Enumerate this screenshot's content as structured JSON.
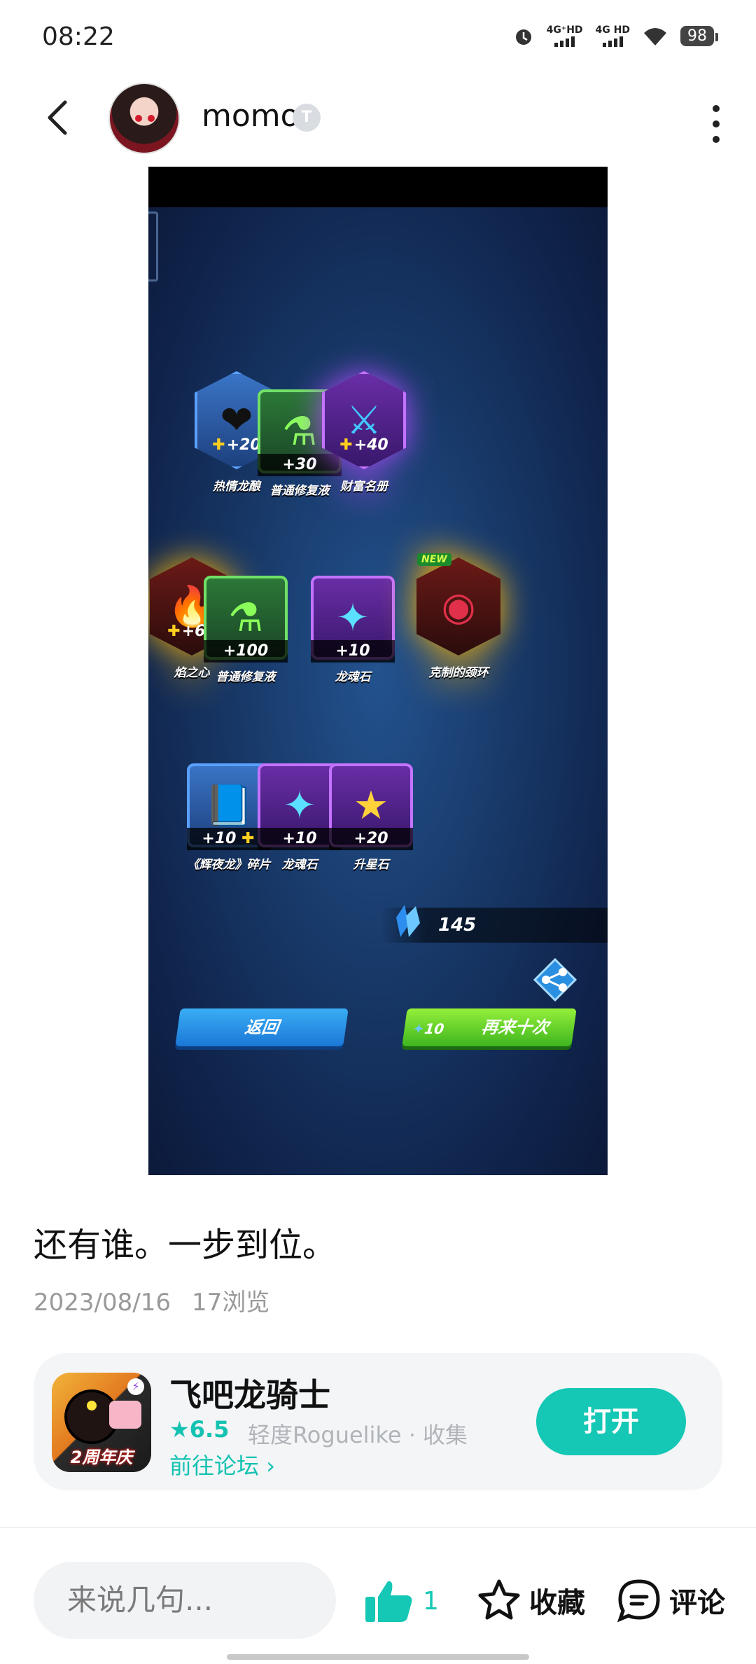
{
  "status_bar": {
    "time": "08:22",
    "network_1": "4G⁺HD",
    "network_2": "4G HD",
    "battery": "98",
    "icons": [
      "alarm-icon",
      "signal-icon",
      "signal-icon",
      "wifi-icon",
      "battery-icon"
    ]
  },
  "header": {
    "username": "momo",
    "badge": "T",
    "icons": [
      "back-arrow-icon",
      "more-vertical-icon"
    ]
  },
  "game": {
    "items": [
      {
        "name": "热情龙酿",
        "qty": "+20",
        "puzzle": true,
        "new": false
      },
      {
        "name": "普通修复液",
        "qty": "+30",
        "puzzle": false,
        "new": false
      },
      {
        "name": "财富名册",
        "qty": "+40",
        "puzzle": true,
        "new": false
      },
      {
        "name": "焰之心",
        "qty": "+60",
        "puzzle": true,
        "new": false
      },
      {
        "name": "普通修复液",
        "qty": "+100",
        "puzzle": false,
        "new": false
      },
      {
        "name": "龙魂石",
        "qty": "+10",
        "puzzle": false,
        "new": false
      },
      {
        "name": "克制的颈环",
        "qty": "",
        "puzzle": false,
        "new": true
      },
      {
        "name": "《辉夜龙》碎片",
        "qty": "+10",
        "puzzle": true,
        "new": false
      },
      {
        "name": "龙魂石",
        "qty": "+10",
        "puzzle": false,
        "new": false
      },
      {
        "name": "升星石",
        "qty": "+20",
        "puzzle": false,
        "new": false
      }
    ],
    "new_tag": "NEW",
    "crystal_count": "145",
    "back_button": "返回",
    "again_cost": "10",
    "again_button": "再来十次"
  },
  "post": {
    "text": "还有谁。一步到位。",
    "date": "2023/08/16",
    "views": "17浏览"
  },
  "app_card": {
    "name": "飞吧龙骑士",
    "rating": "6.5",
    "tags": "轻度Roguelike · 收集",
    "forum_link": "前往论坛",
    "icon_banner": "2周年庆",
    "open_button": "打开"
  },
  "bottom_bar": {
    "comment_placeholder": "来说几句...",
    "like_count": "1",
    "favorite_label": "收藏",
    "comment_label": "评论"
  },
  "colors": {
    "accent": "#15c7b5",
    "meta_gray": "#999999",
    "card_bg": "#f3f5f7"
  }
}
